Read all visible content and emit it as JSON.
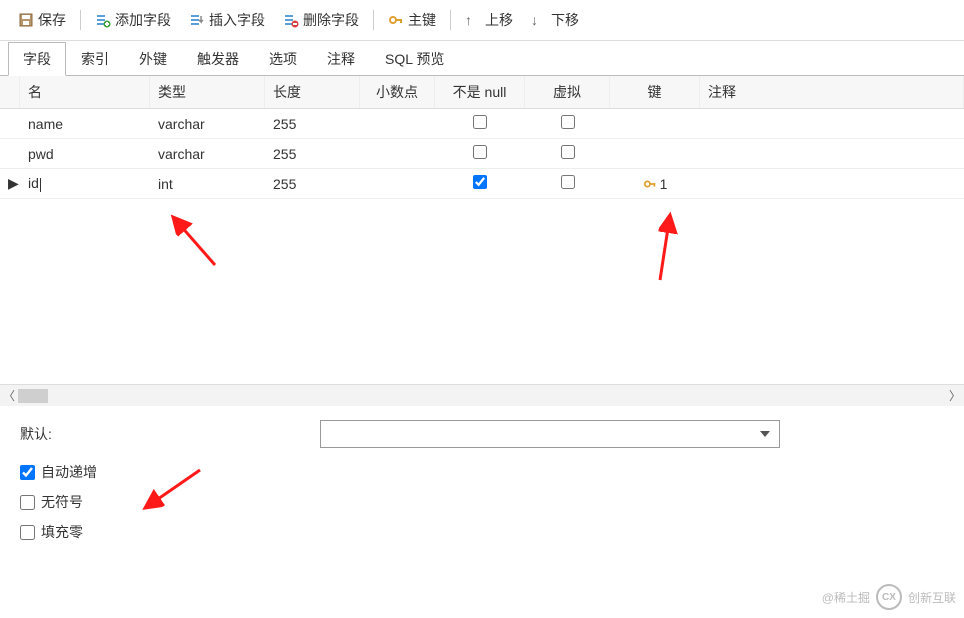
{
  "toolbar": {
    "save": "保存",
    "add_field": "添加字段",
    "insert_field": "插入字段",
    "delete_field": "删除字段",
    "primary_key": "主键",
    "move_up": "上移",
    "move_down": "下移"
  },
  "tabs": {
    "items": [
      {
        "label": "字段",
        "active": true
      },
      {
        "label": "索引",
        "active": false
      },
      {
        "label": "外键",
        "active": false
      },
      {
        "label": "触发器",
        "active": false
      },
      {
        "label": "选项",
        "active": false
      },
      {
        "label": "注释",
        "active": false
      },
      {
        "label": "SQL 预览",
        "active": false
      }
    ]
  },
  "columns": {
    "name": "名",
    "type": "类型",
    "length": "长度",
    "decimal": "小数点",
    "not_null": "不是 null",
    "virtual": "虚拟",
    "key": "键",
    "comment": "注释"
  },
  "rows": [
    {
      "marker": "",
      "name": "name",
      "type": "varchar",
      "length": "255",
      "not_null": false,
      "virtual": false,
      "key": "",
      "comment": ""
    },
    {
      "marker": "",
      "name": "pwd",
      "type": "varchar",
      "length": "255",
      "not_null": false,
      "virtual": false,
      "key": "",
      "comment": ""
    },
    {
      "marker": "▶",
      "name": "id",
      "type": "int",
      "length": "255",
      "not_null": true,
      "virtual": false,
      "key": "1",
      "comment": ""
    }
  ],
  "props": {
    "default_label": "默认:",
    "default_value": "",
    "auto_increment": {
      "label": "自动递增",
      "checked": true
    },
    "unsigned": {
      "label": "无符号",
      "checked": false
    },
    "zerofill": {
      "label": "填充零",
      "checked": false
    }
  },
  "watermark": {
    "text1": "@稀土掘",
    "text2": "创新互联"
  }
}
